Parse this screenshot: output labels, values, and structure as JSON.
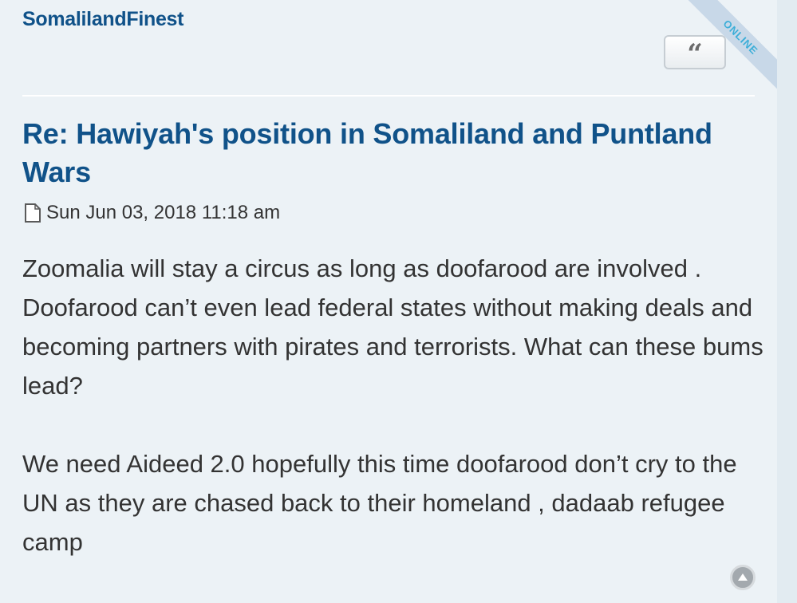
{
  "post": {
    "author": "SomalilandFinest",
    "status_ribbon": "ONLINE",
    "quote_button_glyph": "“",
    "title": "Re: Hawiyah's position in Somaliland and Puntland Wars",
    "post_icon": "document-icon",
    "timestamp": "Sun Jun 03, 2018 11:18 am",
    "paragraphs": [
      "Zoomalia will stay a circus as long as doofarood are involved . Doofarood can’t even lead federal states without making deals and becoming partners with pirates and terrorists. What can these bums lead?",
      "We need Aideed 2.0 hopefully this time doofarood don’t cry to the UN as they are chased back to their homeland , dadaab refugee camp"
    ],
    "back_to_top_icon": "arrow-up-circle-icon"
  },
  "colors": {
    "background": "#ecf2f6",
    "link": "#105289",
    "text": "#333333",
    "ribbon_text": "#3daed8",
    "ribbon_bg": "#c8d8e8"
  }
}
